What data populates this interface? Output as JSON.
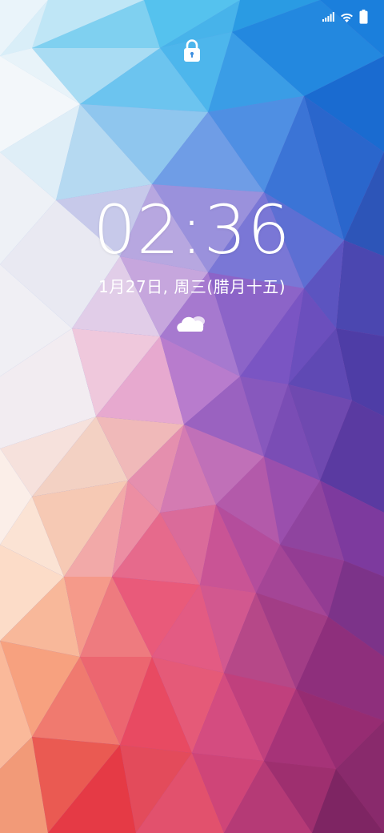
{
  "lockscreen": {
    "time": "02:36",
    "date": "1月27日, 周三(腊月十五)"
  },
  "status_bar": {
    "icons": [
      "signal-icon",
      "wifi-icon",
      "battery-icon"
    ]
  },
  "icons": {
    "lock": "lock-icon",
    "weather": "cloud-icon"
  },
  "colors": {
    "text": "#ffffff",
    "wallpaper_top_right": "#1f6fd6",
    "wallpaper_left": "#f1f1f4",
    "wallpaper_mid": "#8a5fc7",
    "wallpaper_bottom": "#e84b5c"
  }
}
